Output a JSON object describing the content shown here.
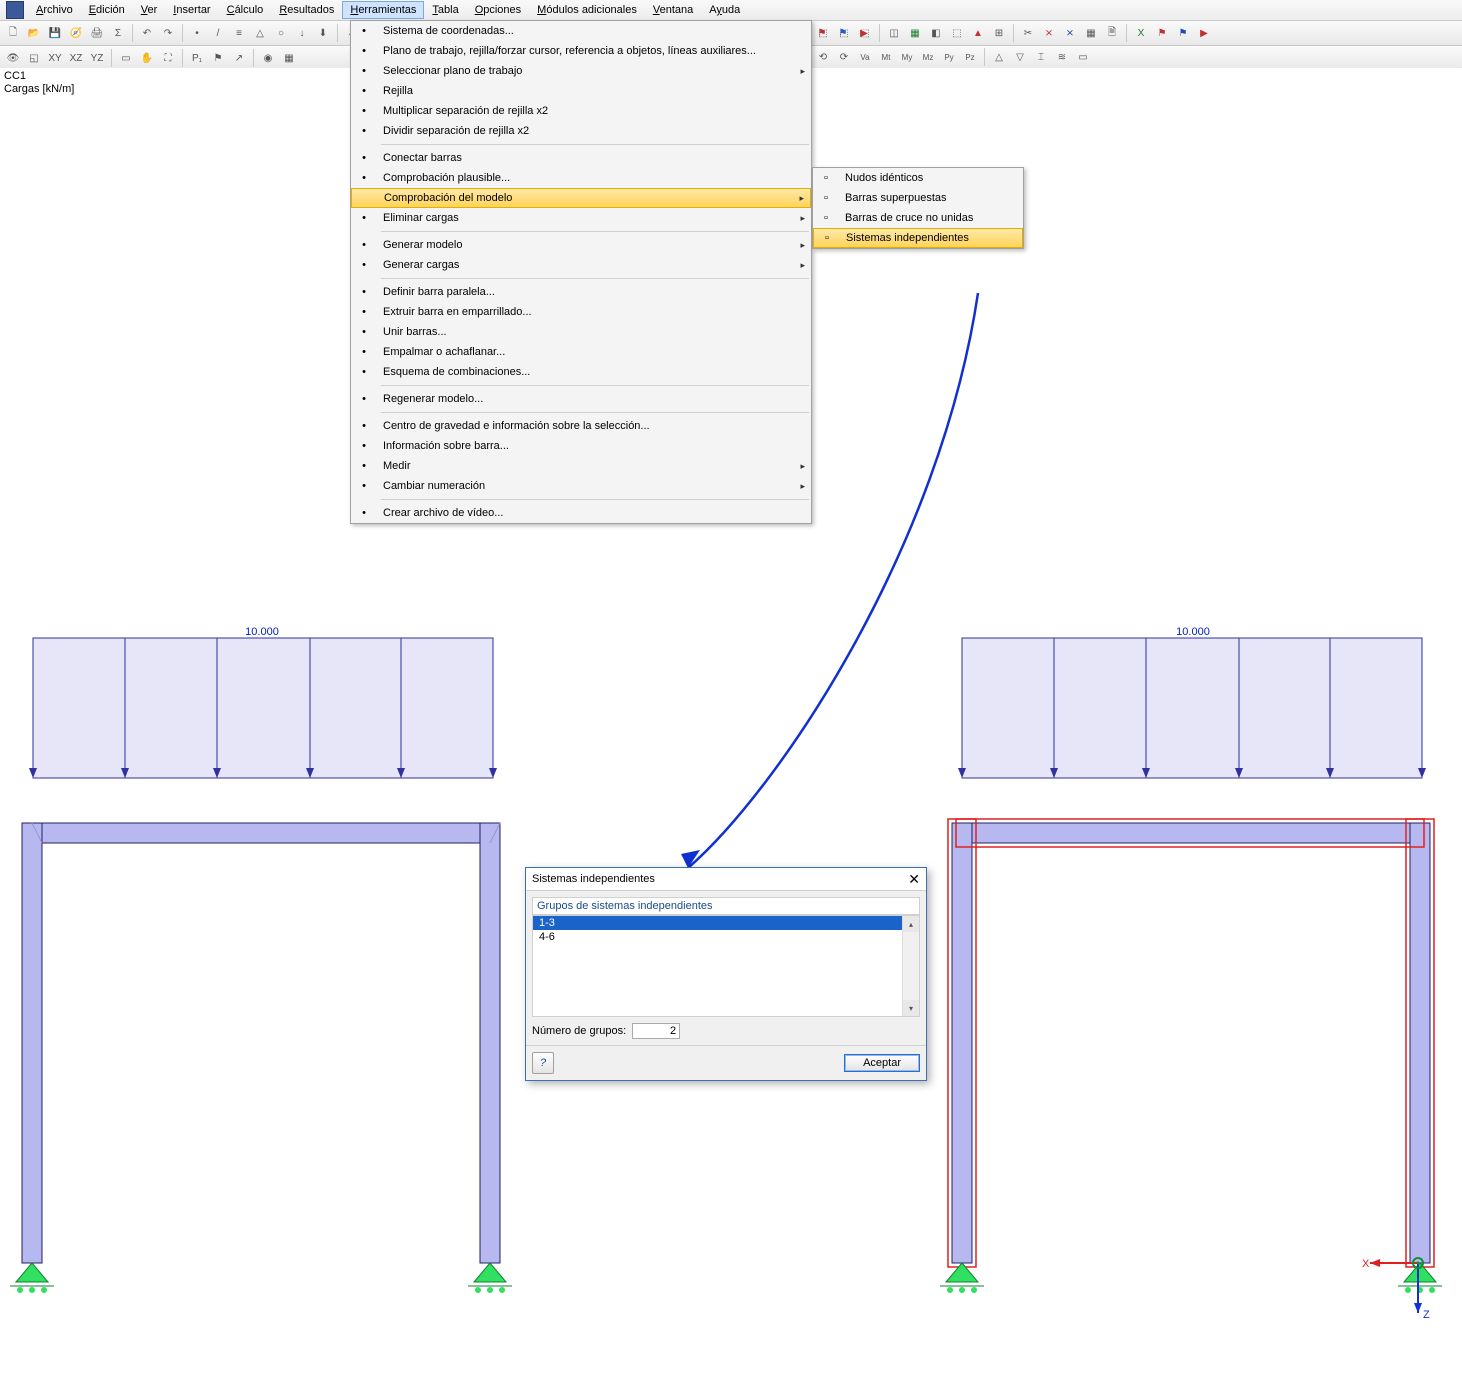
{
  "menubar": {
    "items": [
      {
        "label": "Archivo",
        "accel": "A"
      },
      {
        "label": "Edición",
        "accel": "E"
      },
      {
        "label": "Ver",
        "accel": "V"
      },
      {
        "label": "Insertar",
        "accel": "I"
      },
      {
        "label": "Cálculo",
        "accel": "C"
      },
      {
        "label": "Resultados",
        "accel": "R"
      },
      {
        "label": "Herramientas",
        "accel": "H"
      },
      {
        "label": "Tabla",
        "accel": "T"
      },
      {
        "label": "Opciones",
        "accel": "O"
      },
      {
        "label": "Módulos adicionales",
        "accel": "M"
      },
      {
        "label": "Ventana",
        "accel": "V"
      },
      {
        "label": "Ayuda",
        "accel": "y"
      }
    ],
    "active_index": 6
  },
  "menu_tools": {
    "groups": [
      [
        {
          "label": "Sistema de coordenadas...",
          "sub": false
        },
        {
          "label": "Plano de trabajo, rejilla/forzar cursor, referencia a objetos, líneas auxiliares...",
          "sub": false
        },
        {
          "label": "Seleccionar plano de trabajo",
          "sub": true
        },
        {
          "label": "Rejilla",
          "sub": false
        },
        {
          "label": "Multiplicar separación de rejilla x2",
          "sub": false
        },
        {
          "label": "Dividir separación de rejilla x2",
          "sub": false
        }
      ],
      [
        {
          "label": "Conectar barras",
          "sub": false
        },
        {
          "label": "Comprobación plausible...",
          "sub": false
        },
        {
          "label": "Comprobación del modelo",
          "sub": true,
          "hl": true
        },
        {
          "label": "Eliminar cargas",
          "sub": true
        }
      ],
      [
        {
          "label": "Generar modelo",
          "sub": true
        },
        {
          "label": "Generar cargas",
          "sub": true
        }
      ],
      [
        {
          "label": "Definir barra paralela...",
          "sub": false
        },
        {
          "label": "Extruir barra en emparrillado...",
          "sub": false
        },
        {
          "label": "Unir barras...",
          "sub": false
        },
        {
          "label": "Empalmar o achaflanar...",
          "sub": false
        },
        {
          "label": "Esquema de combinaciones...",
          "sub": false
        }
      ],
      [
        {
          "label": "Regenerar modelo...",
          "sub": false
        }
      ],
      [
        {
          "label": "Centro de gravedad e información sobre la selección...",
          "sub": false
        },
        {
          "label": "Información sobre barra...",
          "sub": false
        },
        {
          "label": "Medir",
          "sub": true
        },
        {
          "label": "Cambiar numeración",
          "sub": true
        }
      ],
      [
        {
          "label": "Crear archivo de vídeo...",
          "sub": false
        }
      ]
    ]
  },
  "submenu_model": {
    "items": [
      {
        "label": "Nudos idénticos"
      },
      {
        "label": "Barras superpuestas"
      },
      {
        "label": "Barras de cruce no unidas"
      },
      {
        "label": "Sistemas independientes",
        "hl": true
      }
    ]
  },
  "status": {
    "line1": "CC1",
    "line2": "Cargas [kN/m]"
  },
  "loads": {
    "left_label": "10.000",
    "right_label": "10.000"
  },
  "dialog": {
    "title": "Sistemas independientes",
    "list_header": "Grupos de sistemas independientes",
    "items": [
      "1-3",
      "4-6"
    ],
    "selected_index": 0,
    "count_label": "Número de grupos:",
    "count_value": "2",
    "ok": "Aceptar",
    "help": "?"
  },
  "axes": {
    "x": "X",
    "z": "Z"
  }
}
